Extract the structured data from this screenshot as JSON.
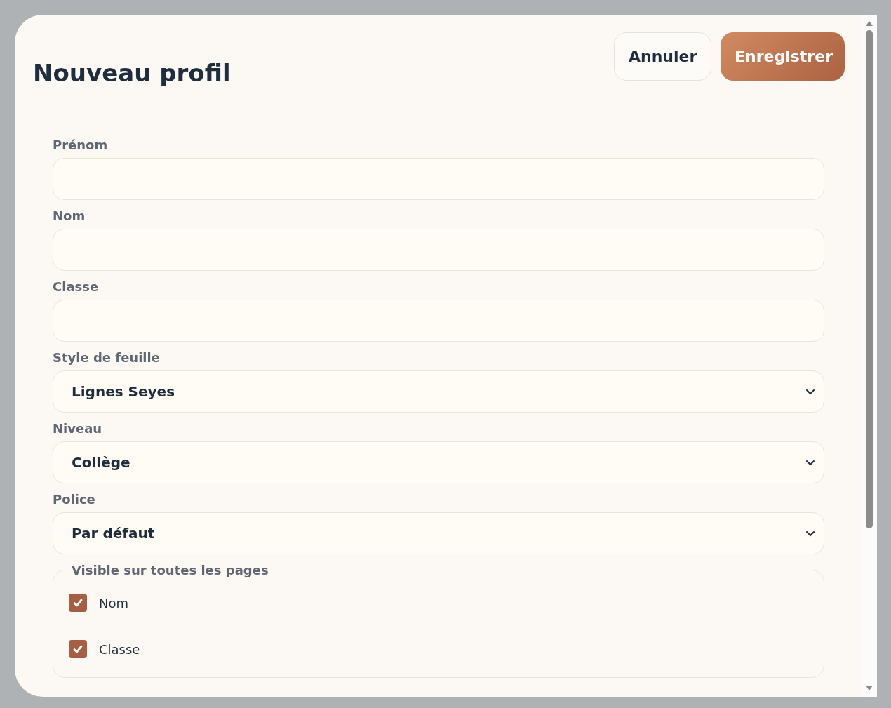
{
  "dialog": {
    "title": "Nouveau profil",
    "buttons": [
      {
        "label": "Annuler",
        "kind": "secondary"
      },
      {
        "label": "Enregistrer",
        "kind": "primary"
      }
    ]
  },
  "fields": [
    {
      "label": "Prénom",
      "kind": "text"
    },
    {
      "label": "Nom",
      "kind": "text"
    },
    {
      "label": "Classe",
      "kind": "text"
    },
    {
      "label": "Style de feuille",
      "kind": "select",
      "value": "Lignes Seyes"
    },
    {
      "label": "Niveau",
      "kind": "select",
      "value": "Collège"
    },
    {
      "label": "Police",
      "kind": "select",
      "value": "Par défaut"
    }
  ],
  "visibility": {
    "legend": "Visible sur toutes les pages",
    "options": [
      {
        "label": "Nom",
        "checked": true
      },
      {
        "label": "Classe",
        "checked": true
      }
    ]
  }
}
